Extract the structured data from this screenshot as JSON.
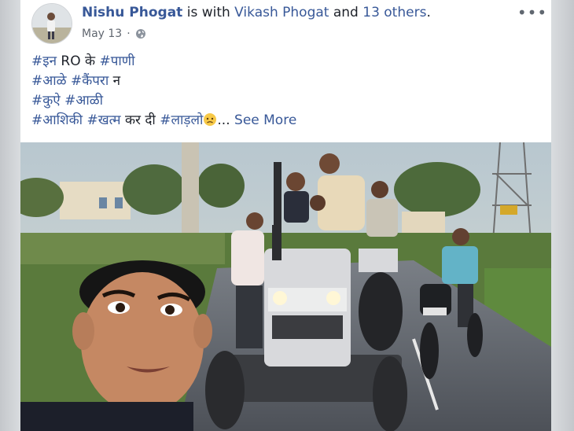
{
  "post": {
    "author": "Nishu Phogat",
    "with_text": " is with ",
    "tagged_person": "Vikash Phogat",
    "and_text": " and ",
    "others": "13 others",
    "period": ".",
    "date": "May 13",
    "privacy_icon": "globe-icon",
    "more_icon": "ellipsis-icon",
    "more_label": "•••",
    "lines": [
      [
        "#इन",
        " RO के ",
        "#पाणी"
      ],
      [
        "#आळे",
        " ",
        "#कैंपरा",
        " न"
      ],
      [
        "#कुऐ",
        " ",
        "#आळी"
      ],
      [
        "#आशिकी",
        " ",
        "#खत्म",
        " कर दी ",
        "#लाड़लो"
      ]
    ],
    "ellipsis": "... ",
    "see_more": "See More",
    "emoji": "sad-face-emoji",
    "photo_icon": "group-selfie-tractor-photo"
  },
  "colors": {
    "link": "#385898",
    "text": "#1d2129",
    "meta": "#616770",
    "background": "#ffffff"
  }
}
